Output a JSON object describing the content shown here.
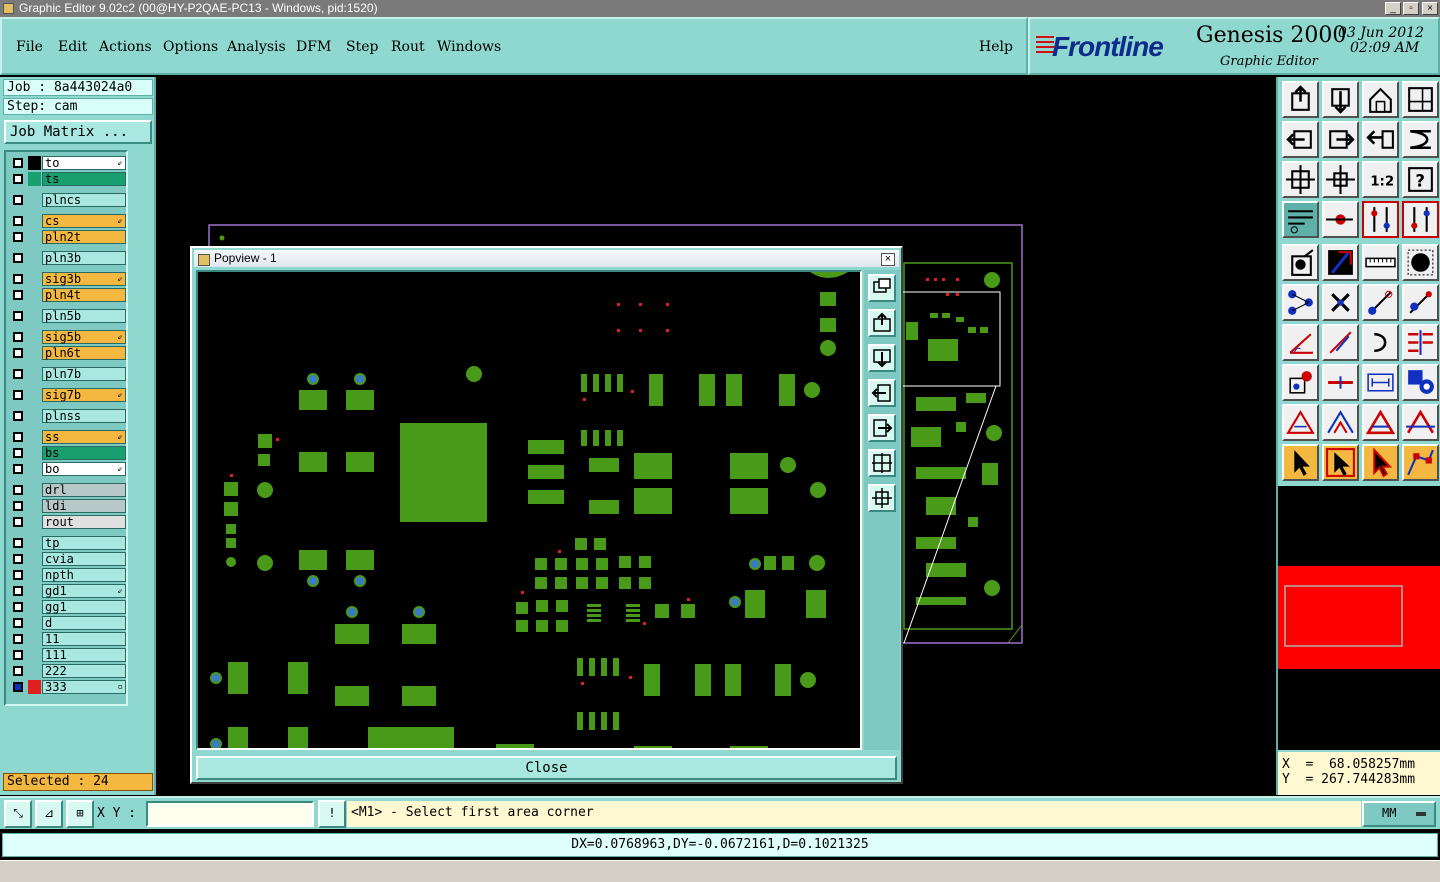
{
  "window": {
    "title": "Graphic Editor 9.02c2 (00@HY-P2QAE-PC13 - Windows, pid:1520)"
  },
  "menu": {
    "items": [
      "File",
      "Edit",
      "Actions",
      "Options",
      "Analysis",
      "DFM",
      "Step",
      "Rout",
      "Windows"
    ],
    "help": "Help"
  },
  "brand": {
    "logo": "Frontline",
    "product": "Genesis 2000",
    "subtitle": "Graphic Editor",
    "date": "03 Jun 2012",
    "time": "02:09 AM"
  },
  "job": {
    "job_label": "Job : 8a443024a0",
    "step_label": "Step: cam",
    "matrix_button": "Job Matrix ..."
  },
  "layers": [
    {
      "name": "to",
      "color": "#ffffff",
      "marker": "⇙",
      "swatch": "#000000"
    },
    {
      "name": "ts",
      "color": "#1aa070",
      "marker": "",
      "swatch": "#1aa070"
    },
    {
      "name": "plncs",
      "color": "#a8e8e0",
      "marker": "",
      "swatch": ""
    },
    {
      "name": "cs",
      "color": "#f4b840",
      "marker": "⇙",
      "swatch": ""
    },
    {
      "name": "pln2t",
      "color": "#f4b840",
      "marker": "",
      "swatch": ""
    },
    {
      "name": "pln3b",
      "color": "#a8e8e0",
      "marker": "",
      "swatch": ""
    },
    {
      "name": "sig3b",
      "color": "#f4b840",
      "marker": "⇙",
      "swatch": ""
    },
    {
      "name": "pln4t",
      "color": "#f4b840",
      "marker": "",
      "swatch": ""
    },
    {
      "name": "pln5b",
      "color": "#a8e8e0",
      "marker": "",
      "swatch": ""
    },
    {
      "name": "sig5b",
      "color": "#f4b840",
      "marker": "⇙",
      "swatch": ""
    },
    {
      "name": "pln6t",
      "color": "#f4b840",
      "marker": "",
      "swatch": ""
    },
    {
      "name": "pln7b",
      "color": "#a8e8e0",
      "marker": "",
      "swatch": ""
    },
    {
      "name": "sig7b",
      "color": "#f4b840",
      "marker": "⇙",
      "swatch": ""
    },
    {
      "name": "plnss",
      "color": "#a8e8e0",
      "marker": "",
      "swatch": ""
    },
    {
      "name": "ss",
      "color": "#f4b840",
      "marker": "⇙",
      "swatch": ""
    },
    {
      "name": "bs",
      "color": "#1aa070",
      "marker": "",
      "swatch": ""
    },
    {
      "name": "bo",
      "color": "#ffffff",
      "marker": "⇙",
      "swatch": ""
    },
    {
      "name": "drl",
      "color": "#b8c8c8",
      "marker": "",
      "swatch": ""
    },
    {
      "name": "ldi",
      "color": "#b8c8c8",
      "marker": "",
      "swatch": ""
    },
    {
      "name": "rout",
      "color": "#e0e0e0",
      "marker": "",
      "swatch": ""
    },
    {
      "name": "tp",
      "color": "#a8e8e0",
      "marker": "",
      "swatch": ""
    },
    {
      "name": "cvia",
      "color": "#a8e8e0",
      "marker": "",
      "swatch": ""
    },
    {
      "name": "npth",
      "color": "#a8e8e0",
      "marker": "",
      "swatch": ""
    },
    {
      "name": "gd1",
      "color": "#a8e8e0",
      "marker": "⇙",
      "swatch": ""
    },
    {
      "name": "gg1",
      "color": "#a8e8e0",
      "marker": "",
      "swatch": ""
    },
    {
      "name": "d",
      "color": "#a8e8e0",
      "marker": "",
      "swatch": ""
    },
    {
      "name": "11",
      "color": "#a8e8e0",
      "marker": "",
      "swatch": ""
    },
    {
      "name": "111",
      "color": "#a8e8e0",
      "marker": "",
      "swatch": ""
    },
    {
      "name": "222",
      "color": "#a8e8e0",
      "marker": "",
      "swatch": ""
    },
    {
      "name": "333",
      "color": "#a8e8e0",
      "marker": "▫",
      "swatch": "#e02020"
    }
  ],
  "selected_label": "Selected : 24",
  "popview": {
    "title": "Popview - 1",
    "close_x": "×",
    "close_button": "Close"
  },
  "coords": {
    "x": "X  =  68.058257mm",
    "y": "Y  = 267.744283mm"
  },
  "command": {
    "xy_label": "X Y :",
    "xy_value": "",
    "info_icon": "!",
    "prompt": "<M1> - Select first area corner",
    "units": "MM"
  },
  "measure_text": "DX=0.0768963,DY=-0.0672161,D=0.1021325",
  "colors": {
    "panel": "#8fd8d0",
    "pad_green": "#4a9a1a",
    "highlight_red": "#ff0000",
    "board_outline": "#a070d0"
  },
  "icons": {
    "toolbar": [
      "home-icon",
      "zoom-home-icon",
      "house-icon",
      "window-icon",
      "pan-left-icon",
      "pan-right-icon",
      "undo-icon",
      "redo-icon",
      "fit-icon",
      "zoom-icon",
      "scale-icon",
      "help-icon",
      "settings-icon",
      "snap-icon",
      "grid-icon",
      "grid2-icon",
      "edit-feature-icon",
      "line-icon",
      "measure-icon",
      "pad-icon",
      "net-icon",
      "cross-icon",
      "arc-icon",
      "arc2-icon",
      "angle-icon",
      "line2-icon",
      "arc3-icon",
      "split-icon",
      "select-area-icon",
      "dash-icon",
      "measure2-icon",
      "shapes-icon",
      "triangle-icon",
      "triangle2-icon",
      "triangle3-icon",
      "triangle4-icon",
      "pointer-icon",
      "pointer2-icon",
      "pointer3-icon",
      "path-icon"
    ]
  }
}
